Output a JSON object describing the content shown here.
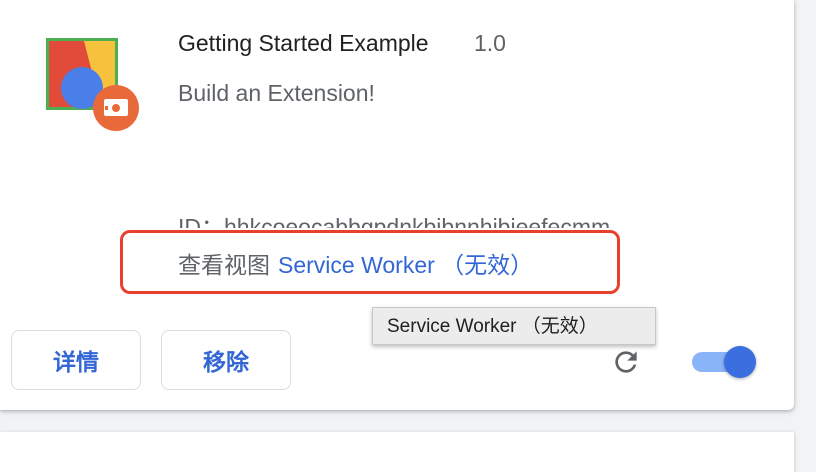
{
  "extension": {
    "name": "Getting Started Example",
    "version": "1.0",
    "description": "Build an Extension!",
    "id_text": "ID：hhkcoeocabbgpdnkbibnnhibjeefecmm",
    "views_label": "查看视图",
    "views_link": "Service Worker （无效）",
    "enabled": true
  },
  "tooltip": {
    "text": "Service Worker （无效）"
  },
  "buttons": {
    "details": "详情",
    "remove": "移除"
  },
  "icons": {
    "logo": "extension-logo-icon",
    "badge": "puzzle-badge-icon",
    "reload": "reload-icon",
    "toggle": "enable-toggle"
  },
  "colors": {
    "link": "#3367d6",
    "highlight": "#e8402f",
    "toggle_on": "#3b6fe0"
  }
}
